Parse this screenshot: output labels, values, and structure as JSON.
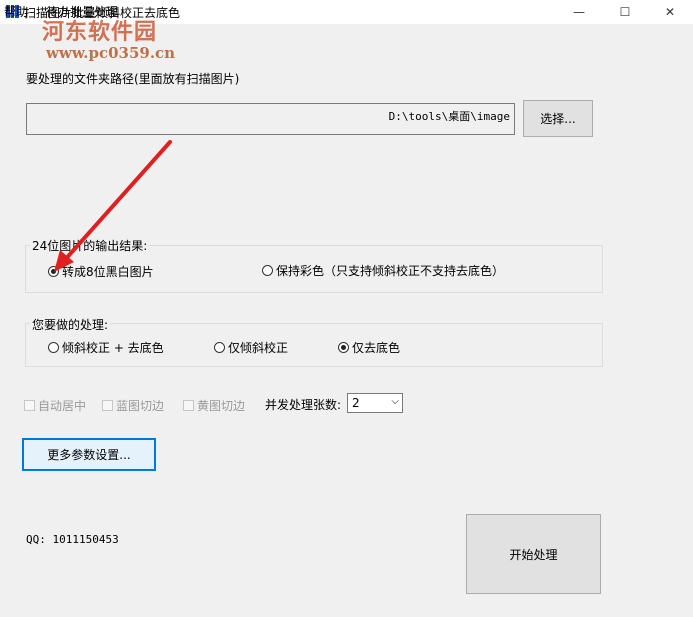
{
  "window": {
    "title": "扫描图片批量倾斜校正去底色",
    "minimize_glyph": "—",
    "maximize_glyph": "☐",
    "close_glyph": "✕"
  },
  "menu": {
    "items": [
      "帮助",
      "待办批量处理"
    ]
  },
  "watermark": {
    "text": "河东软件园",
    "url": "www.pc0359.cn"
  },
  "folder": {
    "label": "要处理的文件夹路径(里面放有扫描图片)",
    "path_value": "D:\\tools\\桌面\\image",
    "select_button": "选择..."
  },
  "output_group": {
    "title": "24位图片的输出结果:",
    "options": [
      {
        "label": "转成8位黑白图片",
        "selected": true
      },
      {
        "label": "保持彩色（只支持倾斜校正不支持去底色）",
        "selected": false
      }
    ]
  },
  "process_group": {
    "title": "您要做的处理:",
    "options": [
      {
        "label": "倾斜校正 + 去底色",
        "selected": false
      },
      {
        "label": "仅倾斜校正",
        "selected": false
      },
      {
        "label": "仅去底色",
        "selected": true
      }
    ]
  },
  "checkboxes": [
    {
      "label": "自动居中",
      "checked": false,
      "enabled": false
    },
    {
      "label": "蓝图切边",
      "checked": false,
      "enabled": false
    },
    {
      "label": "黄图切边",
      "checked": false,
      "enabled": false
    }
  ],
  "concurrent": {
    "label": "并发处理张数:",
    "value": "2"
  },
  "more_params_button": "更多参数设置...",
  "qq": "QQ: 1011150453",
  "start_button": "开始处理",
  "colors": {
    "arrow": "#e02020",
    "focus_border": "#0078d7",
    "window_bg": "#f0f0f0"
  }
}
